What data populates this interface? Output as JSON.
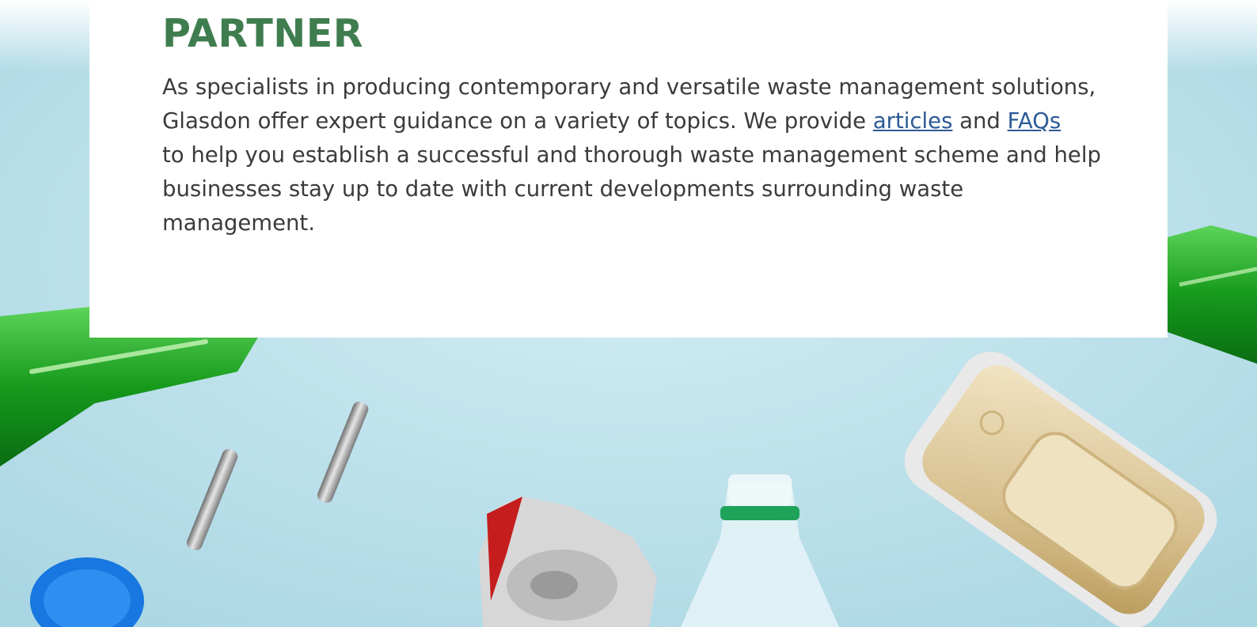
{
  "partner_section": {
    "heading": "PARTNER",
    "intro": "As specialists in producing contemporary and versatile waste management solutions, Glasdon offer expert guidance on a variety of topics. We provide",
    "articles_link": "articles",
    "and_text": "and",
    "faqs_link": "FAQs",
    "outro": "to help you establish a successful and thorough waste management scheme and help businesses stay up to date with current developments surrounding waste management."
  },
  "colors": {
    "heading_green": "#3f7d4f",
    "link_blue": "#2c5a96",
    "body_text": "#3b3b3b",
    "background_blue": "#c4e4ef"
  }
}
